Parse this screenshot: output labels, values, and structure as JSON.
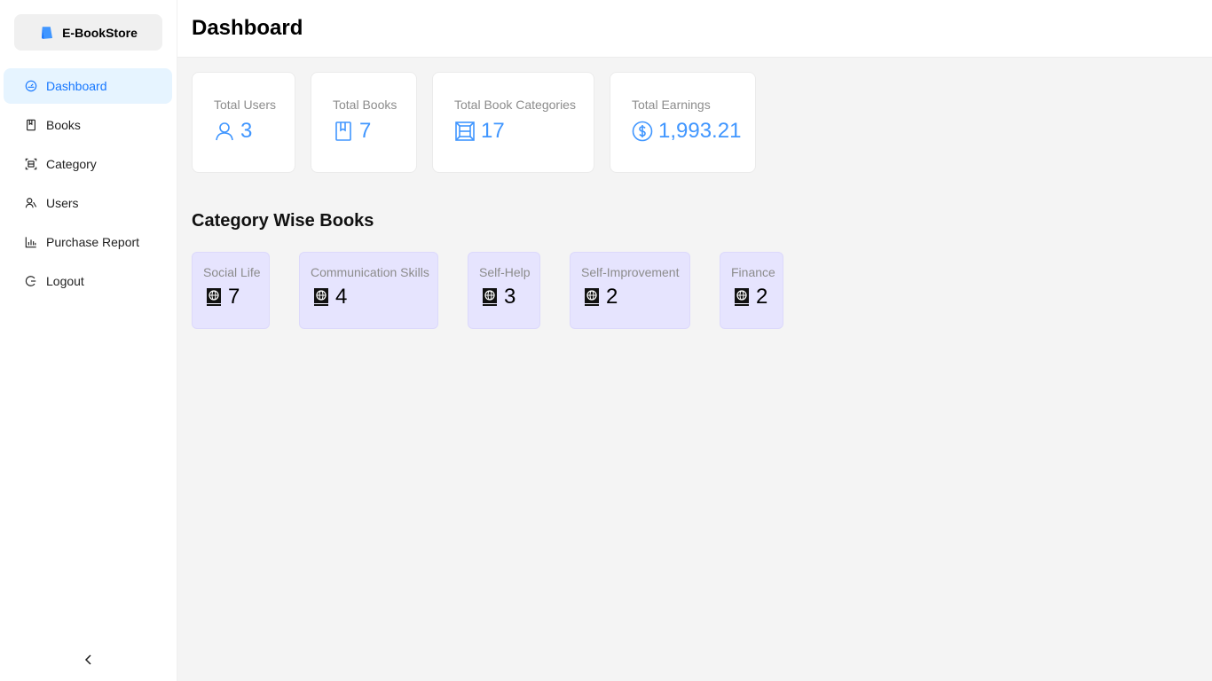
{
  "brand": {
    "name": "E-BookStore",
    "icon": "book-icon",
    "icon_color": "#4096ff"
  },
  "sidebar": {
    "items": [
      {
        "key": "dashboard",
        "label": "Dashboard",
        "icon": "dashboard-icon",
        "active": true
      },
      {
        "key": "books",
        "label": "Books",
        "icon": "book-icon",
        "active": false
      },
      {
        "key": "category",
        "label": "Category",
        "icon": "category-icon",
        "active": false
      },
      {
        "key": "users",
        "label": "Users",
        "icon": "users-icon",
        "active": false
      },
      {
        "key": "purchase-report",
        "label": "Purchase Report",
        "icon": "bar-chart-icon",
        "active": false
      },
      {
        "key": "logout",
        "label": "Logout",
        "icon": "logout-icon",
        "active": false
      }
    ],
    "collapse_icon": "chevron-left-icon"
  },
  "header": {
    "title": "Dashboard"
  },
  "stats": [
    {
      "title": "Total Users",
      "value": "3",
      "icon": "user-icon"
    },
    {
      "title": "Total Books",
      "value": "7",
      "icon": "book-icon"
    },
    {
      "title": "Total Book Categories",
      "value": "17",
      "icon": "category-icon"
    },
    {
      "title": "Total Earnings",
      "value": "1,993.21",
      "icon": "dollar-icon"
    }
  ],
  "category_section": {
    "title": "Category Wise Books",
    "categories": [
      {
        "name": "Social Life",
        "count": "7"
      },
      {
        "name": "Communication Skills",
        "count": "4"
      },
      {
        "name": "Self-Help",
        "count": "3"
      },
      {
        "name": "Self-Improvement",
        "count": "2"
      },
      {
        "name": "Finance",
        "count": "2"
      }
    ],
    "icon": "globe-book-icon"
  },
  "colors": {
    "accent": "#4096ff",
    "active_bg": "#e6f4ff",
    "active_text": "#1677ff",
    "category_bg": "#e6e4fe"
  }
}
